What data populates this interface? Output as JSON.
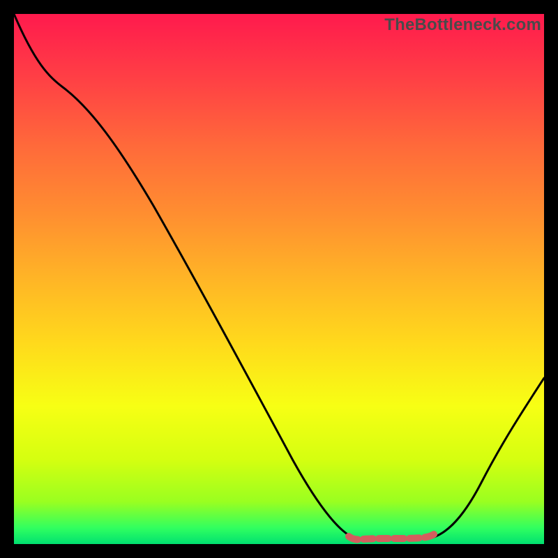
{
  "watermark": "TheBottleneck.com",
  "colors": {
    "background": "#000000",
    "curve_stroke": "#000000",
    "trough_marker": "#d35e5e",
    "gradient_stops": [
      "#ff1a4d",
      "#ff3f45",
      "#ff6a3a",
      "#ff8f30",
      "#ffb526",
      "#ffd91c",
      "#f7ff14",
      "#d5ff10",
      "#9aff20",
      "#30ff60",
      "#00e070"
    ]
  },
  "chart_data": {
    "type": "line",
    "title": "",
    "xlabel": "",
    "ylabel": "",
    "x": [
      0.0,
      0.05,
      0.1,
      0.15,
      0.2,
      0.25,
      0.3,
      0.35,
      0.4,
      0.45,
      0.5,
      0.55,
      0.6,
      0.65,
      0.7,
      0.75,
      0.8,
      0.85,
      0.9,
      0.95,
      1.0
    ],
    "values": [
      1.0,
      0.93,
      0.86,
      0.77,
      0.67,
      0.57,
      0.47,
      0.37,
      0.27,
      0.18,
      0.1,
      0.05,
      0.02,
      0.0,
      0.0,
      0.0,
      0.02,
      0.07,
      0.14,
      0.22,
      0.31
    ],
    "ylim": [
      0,
      1
    ],
    "xlim": [
      0,
      1
    ],
    "trough_range": [
      0.6,
      0.78
    ],
    "gradient_meaning": "vertical color encodes y-value: red=high, green=low"
  }
}
